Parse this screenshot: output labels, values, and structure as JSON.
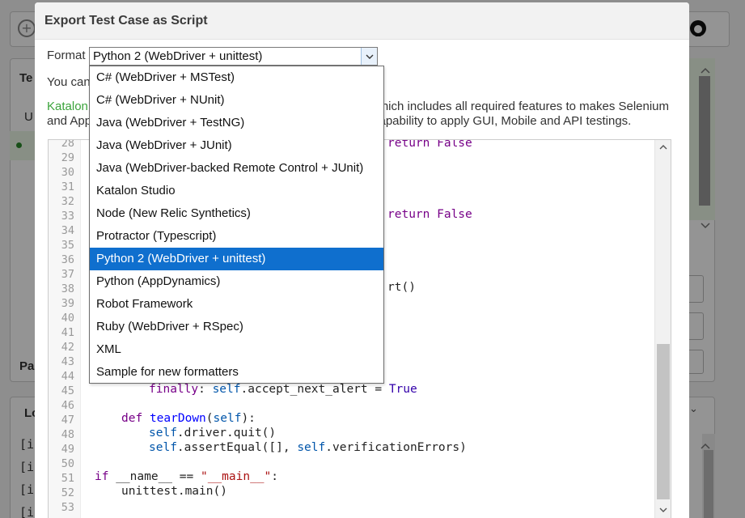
{
  "background": {
    "frag_test_tab": "Te",
    "frag_row_u": "U",
    "frag_pas": "Pa",
    "frag_log_tab": "Lo",
    "frag_log_lines": [
      "[in",
      "[in",
      "[in",
      "[in"
    ]
  },
  "dialog": {
    "title": "Export Test Case as Script",
    "format_label": "Format",
    "format_value": "Python 2 (WebDriver + unittest)",
    "info_line1_prefix": "You can",
    "info_line2_link": "Katalon",
    "info_line2_suffix": "which includes all required features to makes Selenium",
    "info_line3_prefix": "and App",
    "info_line3_suffix": "capability to apply GUI, Mobile and API testings."
  },
  "format_options": [
    {
      "label": "C# (WebDriver + MSTest)",
      "selected": false
    },
    {
      "label": "C# (WebDriver + NUnit)",
      "selected": false
    },
    {
      "label": "Java (WebDriver + TestNG)",
      "selected": false
    },
    {
      "label": "Java (WebDriver + JUnit)",
      "selected": false
    },
    {
      "label": "Java (WebDriver-backed Remote Control + JUnit)",
      "selected": false
    },
    {
      "label": "Katalon Studio",
      "selected": false
    },
    {
      "label": "Node (New Relic Synthetics)",
      "selected": false
    },
    {
      "label": "Protractor (Typescript)",
      "selected": false
    },
    {
      "label": "Python 2 (WebDriver + unittest)",
      "selected": true
    },
    {
      "label": "Python (AppDynamics)",
      "selected": false
    },
    {
      "label": "Robot Framework",
      "selected": false
    },
    {
      "label": "Ruby (WebDriver + RSpec)",
      "selected": false
    },
    {
      "label": "XML",
      "selected": false
    },
    {
      "label": "Sample for new formatters",
      "selected": false
    }
  ],
  "code": {
    "line_numbers": [
      "28",
      "29",
      "30",
      "31",
      "32",
      "33",
      "34",
      "35",
      "36",
      "37",
      "38",
      "39",
      "40",
      "41",
      "42",
      "43",
      "44",
      "45",
      "46",
      "47",
      "48",
      "49",
      "50",
      "51",
      "52",
      "53"
    ],
    "visible_fragments": {
      "line28": "return False",
      "line33": "return False",
      "line38": "rt()",
      "line45_a": "finally",
      "line45_b": ": ",
      "line45_c": "self",
      "line45_d": ".accept_next_alert = ",
      "line45_e": "True",
      "line47_a": "def",
      "line47_b": "tearDown",
      "line47_c": "(",
      "line47_d": "self",
      "line47_e": "):",
      "line48_a": "self",
      "line48_b": ".driver.quit()",
      "line49_a": "self",
      "line49_b": ".assertEqual([], ",
      "line49_c": "self",
      "line49_d": ".verificationErrors)",
      "line51_a": "if",
      "line51_b": " __name__ == ",
      "line51_c": "\"__main__\"",
      "line51_d": ":",
      "line52": "unittest.main()"
    }
  },
  "colors": {
    "selection": "#0f6fce",
    "keyword": "#770088",
    "string": "#aa1111",
    "link": "#3ba33b"
  }
}
